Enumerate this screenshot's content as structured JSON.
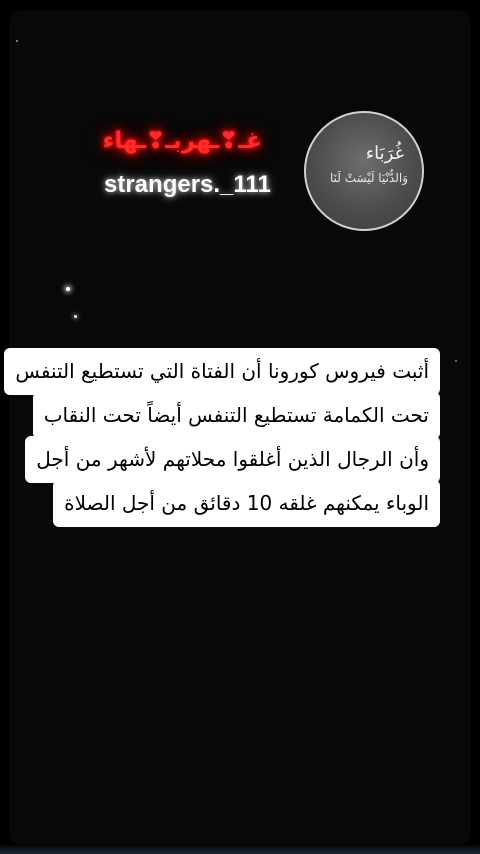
{
  "profile": {
    "neon_name": "غـ❣ـهربـ❣ـهاء",
    "username": "strangers._111",
    "avatar": {
      "title": "غُرَبَاء",
      "subtitle": "وَالدُّنْيَا لَيْسَتْ لَنَا"
    }
  },
  "caption": {
    "lines": [
      "أثبت فيروس كورونا أن الفتاة التي تستطيع التنفس",
      "تحت الكمامة تستطيع التنفس أيضاً تحت النقاب",
      "وأن الرجال الذين أغلقوا محلاتهم لأشهر من أجل",
      "الوباء يمكنهم غلقه 10 دقائق من أجل الصلاة"
    ]
  },
  "colors": {
    "background": "#000000",
    "neon": "#ff2a2a",
    "caption_bg": "#ffffff",
    "caption_text": "#000000"
  }
}
